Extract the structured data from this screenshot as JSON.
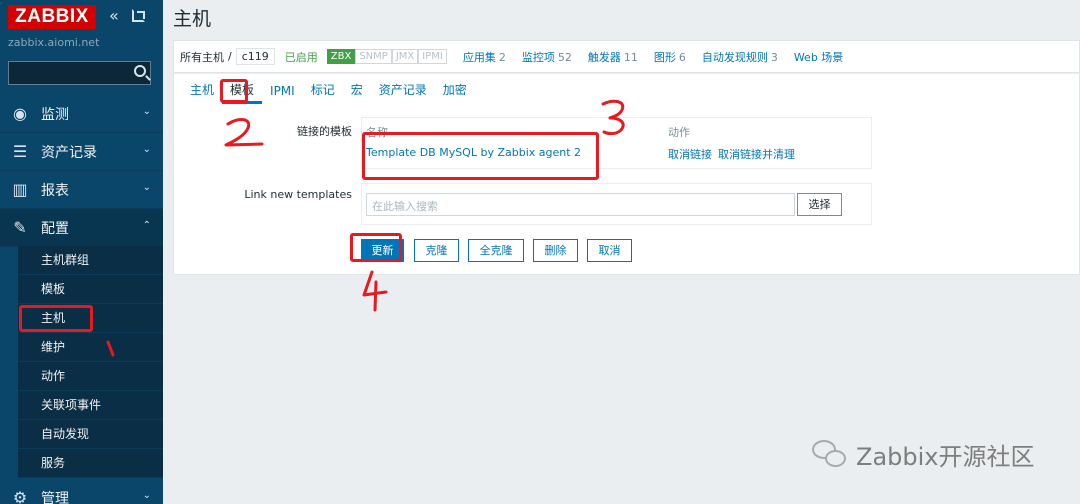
{
  "sidebar": {
    "logo": "ZABBIX",
    "server_name": "zabbix.aiomi.net",
    "sections": [
      {
        "label": "监测",
        "icon": "eye-icon"
      },
      {
        "label": "资产记录",
        "icon": "list-icon"
      },
      {
        "label": "报表",
        "icon": "bar-chart-icon"
      },
      {
        "label": "配置",
        "icon": "wrench-icon"
      },
      {
        "label": "管理",
        "icon": "gear-icon"
      }
    ],
    "config_items": [
      "主机群组",
      "模板",
      "主机",
      "维护",
      "动作",
      "关联项事件",
      "自动发现",
      "服务"
    ]
  },
  "page": {
    "title": "主机"
  },
  "nav": {
    "all_hosts": "所有主机",
    "separator": "/",
    "current_host": "c119",
    "status": "已启用",
    "availability": [
      "ZBX",
      "SNMP",
      "JMX",
      "IPMI"
    ],
    "links": [
      {
        "label": "应用集",
        "count": "2"
      },
      {
        "label": "监控项",
        "count": "52"
      },
      {
        "label": "触发器",
        "count": "11"
      },
      {
        "label": "图形",
        "count": "6"
      },
      {
        "label": "自动发现规则",
        "count": "3"
      },
      {
        "label": "Web 场景",
        "count": ""
      }
    ]
  },
  "tabs": [
    "主机",
    "模板",
    "IPMI",
    "标记",
    "宏",
    "资产记录",
    "加密"
  ],
  "form": {
    "linked_templates_label": "链接的模板",
    "col_name": "名称",
    "col_action": "动作",
    "linked_template": "Template DB MySQL by Zabbix agent 2",
    "unlink": "取消链接",
    "unlink_clear": "取消链接并清理",
    "link_new_label": "Link new templates",
    "input_placeholder": "在此输入搜索",
    "select": "选择"
  },
  "buttons": {
    "update": "更新",
    "clone": "克隆",
    "full_clone": "全克隆",
    "delete": "删除",
    "cancel": "取消"
  },
  "watermark": "Zabbix开源社区",
  "colors": {
    "sidebar_bg": "#0a466a",
    "accent": "#0275b8",
    "enabled": "#429e47",
    "annotation": "#e8191f"
  }
}
